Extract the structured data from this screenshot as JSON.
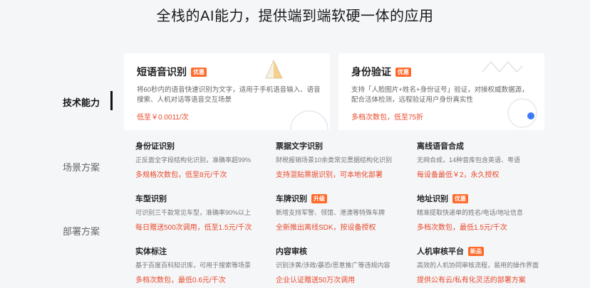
{
  "headline": "全栈的AI能力，提供端到端软硬一体的应用",
  "nav": {
    "items": [
      {
        "label": "技术能力",
        "active": true
      },
      {
        "label": "场景方案",
        "active": false
      },
      {
        "label": "部署方案",
        "active": false
      }
    ]
  },
  "featured": [
    {
      "title": "短语音识别",
      "badge": "优惠",
      "desc": "将60秒内的语音快速识别为文字，适用于手机语音输入、语音搜索、人机对话等语音交互场景",
      "price": "低至￥0.0011/次"
    },
    {
      "title": "身份验证",
      "badge": "优惠",
      "desc": "支持「人脸图片+姓名+身份证号」验证，对接权威数据源，配合活体检测，远程验证用户身份真实性",
      "price": "多档次数包，低至75折"
    }
  ],
  "products": [
    {
      "title": "身份证识别",
      "badge": "",
      "desc": "正反面全字段结构化识别，准确率超99%",
      "price": "多规格次数包，低至8元/千次"
    },
    {
      "title": "票据文字识别",
      "badge": "",
      "desc": "财税报销场景10余类常见票据结构化识别",
      "price": "支持混贴票据识别，可本地化部署"
    },
    {
      "title": "离线语音合成",
      "badge": "",
      "desc": "无网合成，14种音库包含英语、粤语",
      "price": "每设备最低￥2，永久授权"
    },
    {
      "title": "车型识别",
      "badge": "",
      "desc": "可识别三千款常见车型，准确率90%以上",
      "price": "每日赠送500次调用，低至1.5元/千次"
    },
    {
      "title": "车牌识别",
      "badge": "升级",
      "desc": "新增支持军警、领馆、港澳等特殊车牌",
      "price": "全新推出离线SDK，按设备授权"
    },
    {
      "title": "地址识别",
      "badge": "优惠",
      "desc": "精准提取快递单的姓名/电话/地址信息",
      "price": "多档次数包，最低1.5元/千次"
    },
    {
      "title": "实体标注",
      "badge": "",
      "desc": "基于百度百科知识库，可用于搜索等场景",
      "price": "多档次数包，最低0.6元/千次"
    },
    {
      "title": "内容审核",
      "badge": "",
      "desc": "识别涉黄/涉政/暴恐/恶意推广等违规内容",
      "price": "企业认证赠送50万次调用"
    },
    {
      "title": "人机审核平台",
      "badge": "新品",
      "desc": "高效的人机协同审核流程，易用的操作界面",
      "price": "提供公有云/私有化灵活的部署方案"
    }
  ],
  "colors": {
    "accent": "#e8492b",
    "badge": "#ff6a2b",
    "background": "#f5f6f8"
  }
}
